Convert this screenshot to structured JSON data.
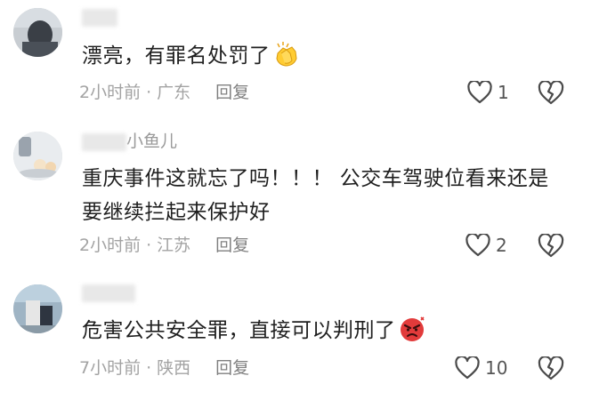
{
  "comments": [
    {
      "username_visible": "",
      "text": "漂亮，有罪名处罚了",
      "emoji_icon": "clapping-hands-emoji",
      "time": "2小时前",
      "location": "广东",
      "reply_label": "回复",
      "like_count": "1"
    },
    {
      "username_visible": "小鱼儿",
      "text": "重庆事件这就忘了吗！！！ 公交车驾驶位看来还是要继续拦起来保护好",
      "time": "2小时前",
      "location": "江苏",
      "reply_label": "回复",
      "like_count": "2"
    },
    {
      "username_visible": "",
      "text": "危害公共安全罪，直接可以判刑了",
      "emoji_icon": "angry-face-emoji",
      "time": "7小时前",
      "location": "陕西",
      "reply_label": "回复",
      "like_count": "10"
    }
  ],
  "separator": "·",
  "icons": {
    "like": "heart-outline-icon",
    "dislike": "broken-heart-icon"
  },
  "colors": {
    "text": "#1f1f1f",
    "meta": "#a3a3a3",
    "icon": "#4a4a4a"
  }
}
